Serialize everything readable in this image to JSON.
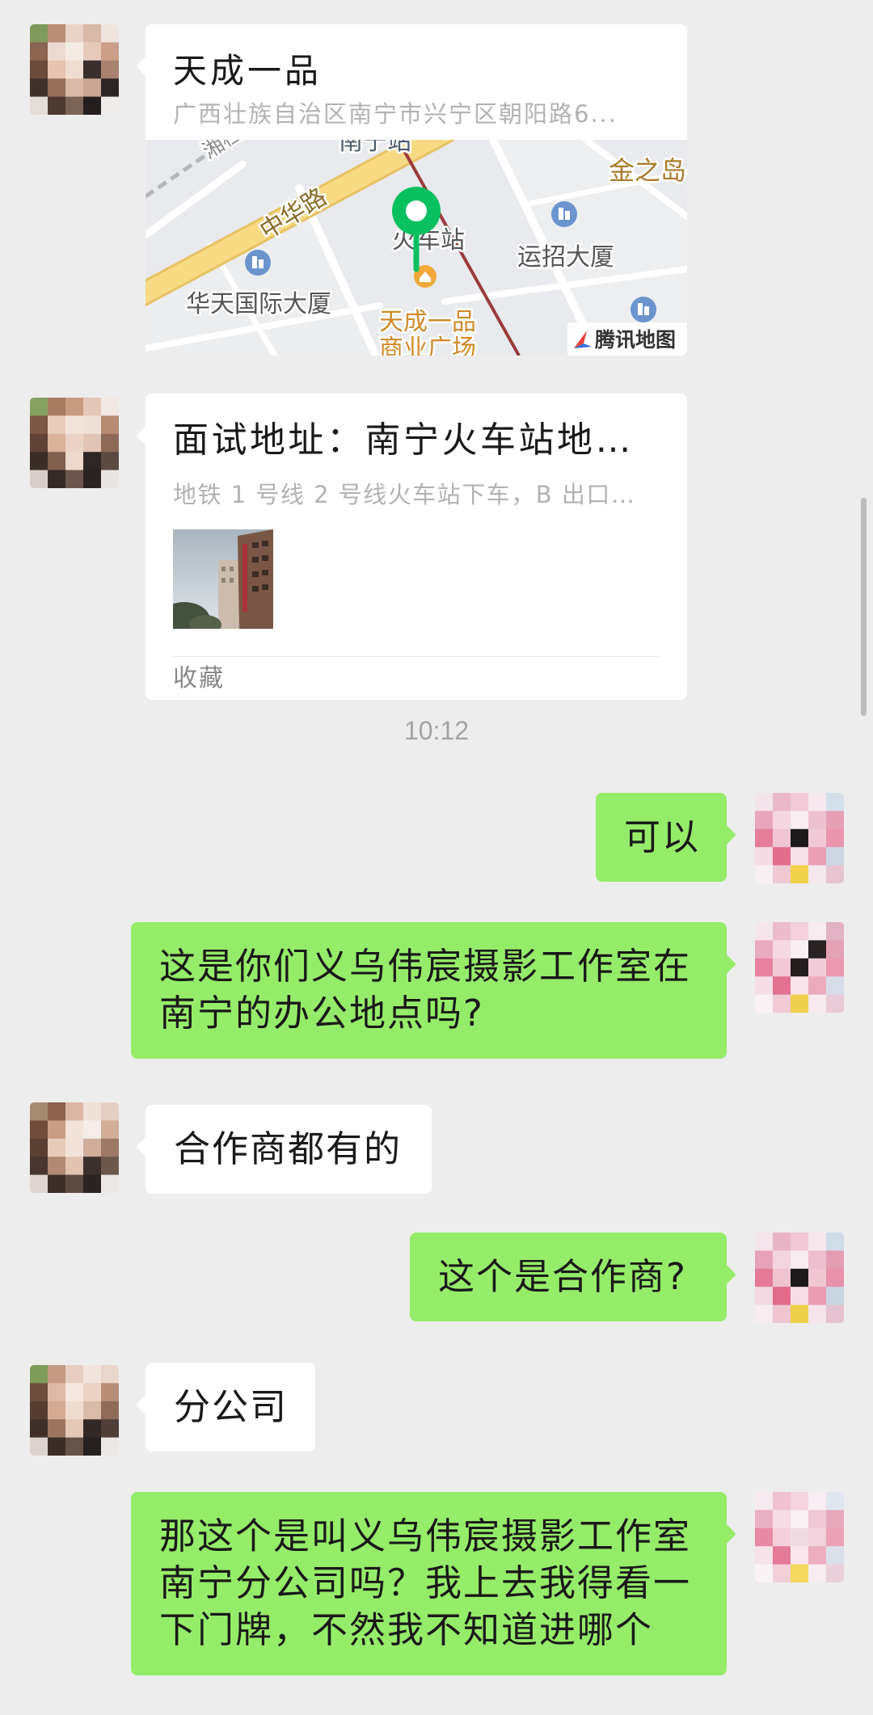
{
  "location_card": {
    "title": "天成一品",
    "address": "广西壮族自治区南宁市兴宁区朝阳路6...",
    "map": {
      "labels": {
        "xianggui": "湘桂",
        "nanning_station": "南宁站",
        "jinzhidao": "金之岛",
        "zhonghua_road": "中华路",
        "railway_station": "火车站",
        "yunzhao_building": "运招大厦",
        "huatian_building": "华天国际大厦",
        "tiancheng_line1": "天成一品",
        "tiancheng_line2": "商业广场"
      },
      "provider_label": "腾讯地图",
      "pin_icon": "map-pin-icon",
      "pin_color": "#07c160"
    }
  },
  "favorite_card": {
    "title": "面试地址：南宁火车站地…",
    "description": "地铁 1 号线 2 号线火车站下车，B 出口…",
    "source_label": "收藏"
  },
  "timestamp": "10:12",
  "text_messages": [
    {
      "outgoing": true,
      "lines": [
        "可以"
      ]
    },
    {
      "outgoing": true,
      "lines": [
        "这是你们义乌伟宸摄影工作室在",
        "南宁的办公地点吗?"
      ]
    },
    {
      "outgoing": false,
      "lines": [
        "合作商都有的"
      ]
    },
    {
      "outgoing": true,
      "lines": [
        "这个是合作商?"
      ]
    },
    {
      "outgoing": false,
      "lines": [
        "分公司"
      ]
    },
    {
      "outgoing": true,
      "lines": [
        "那这个是叫义乌伟宸摄影工作室",
        "南宁分公司吗？我上去我得看一",
        "下门牌，不然我不知道进哪个"
      ]
    }
  ],
  "colors": {
    "background": "#ededed",
    "outgoing_bubble": "#95ec69",
    "incoming_bubble": "#ffffff",
    "secondary_text": "#b2b2b2"
  }
}
